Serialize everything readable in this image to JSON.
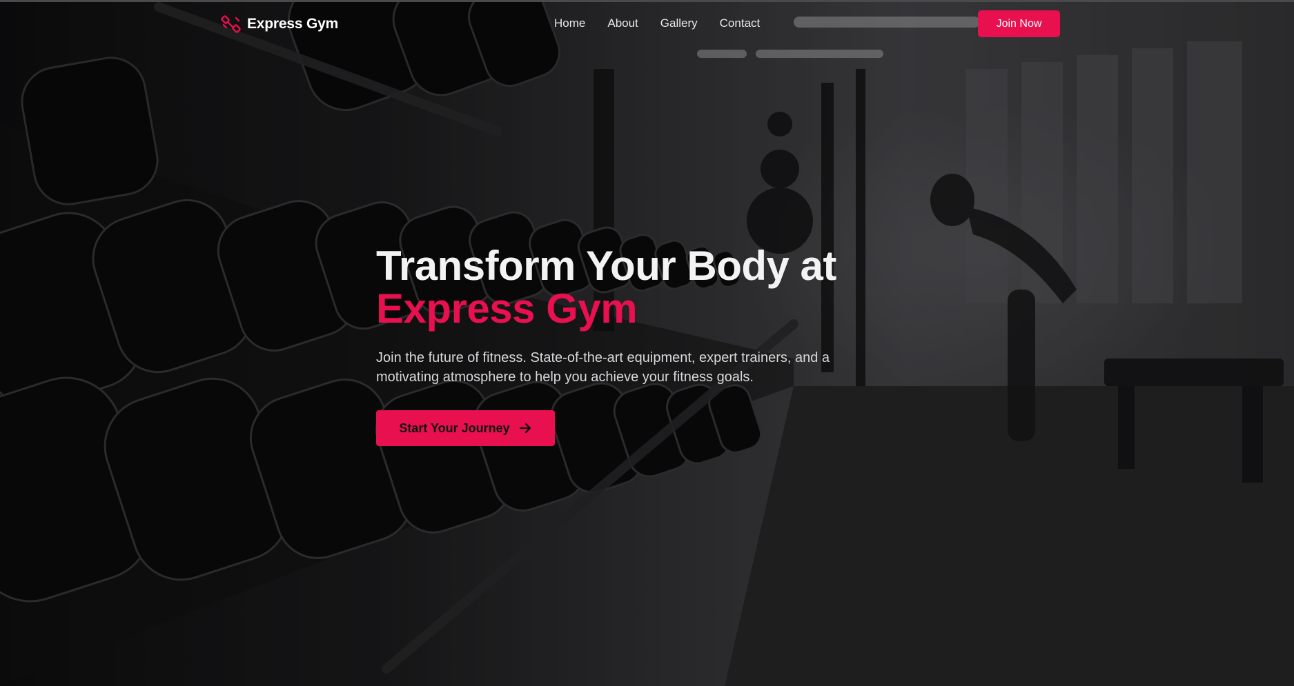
{
  "brand": {
    "name": "Express Gym",
    "icon": "dumbbell-icon",
    "accent_color": "#e8104f"
  },
  "nav": {
    "links": [
      {
        "label": "Home"
      },
      {
        "label": "About"
      },
      {
        "label": "Gallery"
      },
      {
        "label": "Contact"
      }
    ],
    "join_label": "Join Now"
  },
  "hero": {
    "title_line1": "Transform Your Body at",
    "title_line2": "Express Gym",
    "subtitle": "Join the future of fitness. State-of-the-art equipment, expert trainers, and a motivating atmosphere to help you achieve your fitness goals.",
    "cta_label": "Start Your Journey",
    "cta_icon": "arrow-right-icon"
  },
  "colors": {
    "accent": "#e8104f",
    "text_light": "#f3f3f4",
    "background": "#1b1b1d"
  }
}
